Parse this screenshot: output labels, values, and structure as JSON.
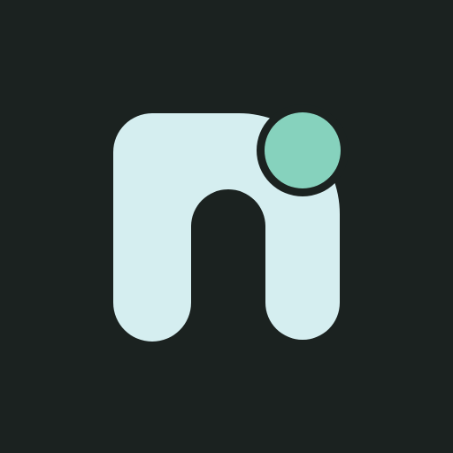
{
  "icon": {
    "name": "ni-logo-icon",
    "description_shape": "stylized lowercase n with dot",
    "colors": {
      "background": "#1b2220",
      "glyph": "#d5eef0",
      "dot": "#86d2bd",
      "dot_ring": "#1b2220"
    }
  }
}
